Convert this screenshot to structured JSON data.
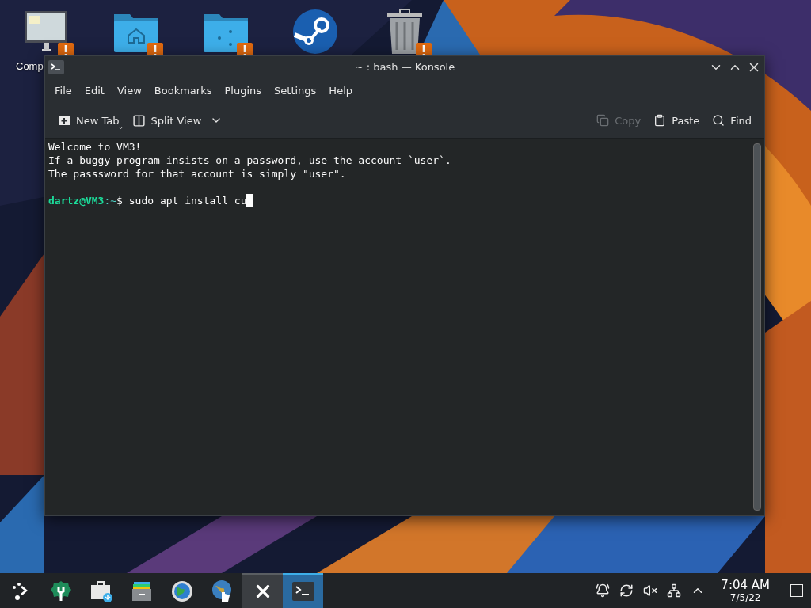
{
  "desktop": {
    "icons": [
      {
        "kind": "computer",
        "label": "Comp",
        "warning": true
      },
      {
        "kind": "home-folder",
        "warning": true
      },
      {
        "kind": "network-folder",
        "warning": true
      },
      {
        "kind": "steam",
        "warning": false
      },
      {
        "kind": "trash",
        "warning": true
      }
    ]
  },
  "window": {
    "title": "~ : bash — Konsole",
    "menu": [
      "File",
      "Edit",
      "View",
      "Bookmarks",
      "Plugins",
      "Settings",
      "Help"
    ],
    "toolbar_left": [
      {
        "kind": "new-tab",
        "label": "New Tab"
      },
      {
        "kind": "split-view",
        "label": "Split View"
      }
    ],
    "toolbar_right": [
      {
        "kind": "copy",
        "label": "Copy",
        "disabled": true
      },
      {
        "kind": "paste",
        "label": "Paste",
        "disabled": false
      },
      {
        "kind": "find",
        "label": "Find",
        "disabled": false
      }
    ],
    "terminal": {
      "lines": [
        "Welcome to VM3!",
        "If a buggy program insists on a password, use the account `user`.",
        "The passsword for that account is simply \"user\"."
      ],
      "prompt": {
        "user": "dartz@VM3",
        "path": ":~",
        "symbol": "$",
        "command": "sudo apt install cu"
      }
    }
  },
  "taskbar": {
    "items": [
      {
        "kind": "launcher",
        "selected": false,
        "highlighted": false
      },
      {
        "kind": "wrench",
        "selected": false,
        "highlighted": false
      },
      {
        "kind": "store",
        "selected": false,
        "highlighted": false
      },
      {
        "kind": "archive",
        "selected": false,
        "highlighted": false
      },
      {
        "kind": "globe",
        "selected": false,
        "highlighted": false
      },
      {
        "kind": "map",
        "selected": false,
        "highlighted": false
      },
      {
        "kind": "close",
        "selected": false,
        "highlighted": true
      },
      {
        "kind": "terminal",
        "selected": true,
        "highlighted": false
      }
    ],
    "tray": [
      {
        "kind": "bell"
      },
      {
        "kind": "update"
      },
      {
        "kind": "muted"
      },
      {
        "kind": "network"
      },
      {
        "kind": "expand"
      }
    ],
    "clock": {
      "time": "7:04 AM",
      "date": "7/5/22"
    }
  }
}
